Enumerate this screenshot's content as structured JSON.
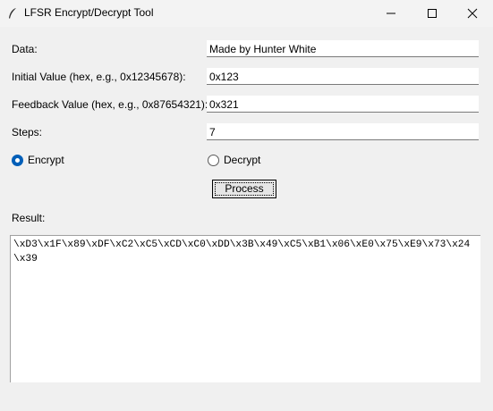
{
  "window": {
    "title": "LFSR Encrypt/Decrypt Tool",
    "icon": "feather-icon",
    "controls": [
      "minimize-icon",
      "maximize-icon",
      "close-icon"
    ]
  },
  "form": {
    "data": {
      "label": "Data:",
      "value": "Made by Hunter White"
    },
    "initial_value": {
      "label": "Initial Value (hex, e.g., 0x12345678):",
      "value": "0x123"
    },
    "feedback_value": {
      "label": "Feedback Value (hex, e.g., 0x87654321):",
      "value": "0x321"
    },
    "steps": {
      "label": "Steps:",
      "value": "7"
    },
    "mode": {
      "encrypt_label": "Encrypt",
      "decrypt_label": "Decrypt",
      "selected": "Encrypt"
    },
    "process_label": "Process"
  },
  "result": {
    "label": "Result:",
    "text": "\\xD3\\x1F\\x89\\xDF\\xC2\\xC5\\xCD\\xC0\\xDD\\x3B\\x49\\xC5\\xB1\\x06\\xE0\\x75\\xE9\\x73\\x24\\x39"
  },
  "colors": {
    "accent": "#005fb8",
    "window_bg": "#f0f0f0"
  }
}
